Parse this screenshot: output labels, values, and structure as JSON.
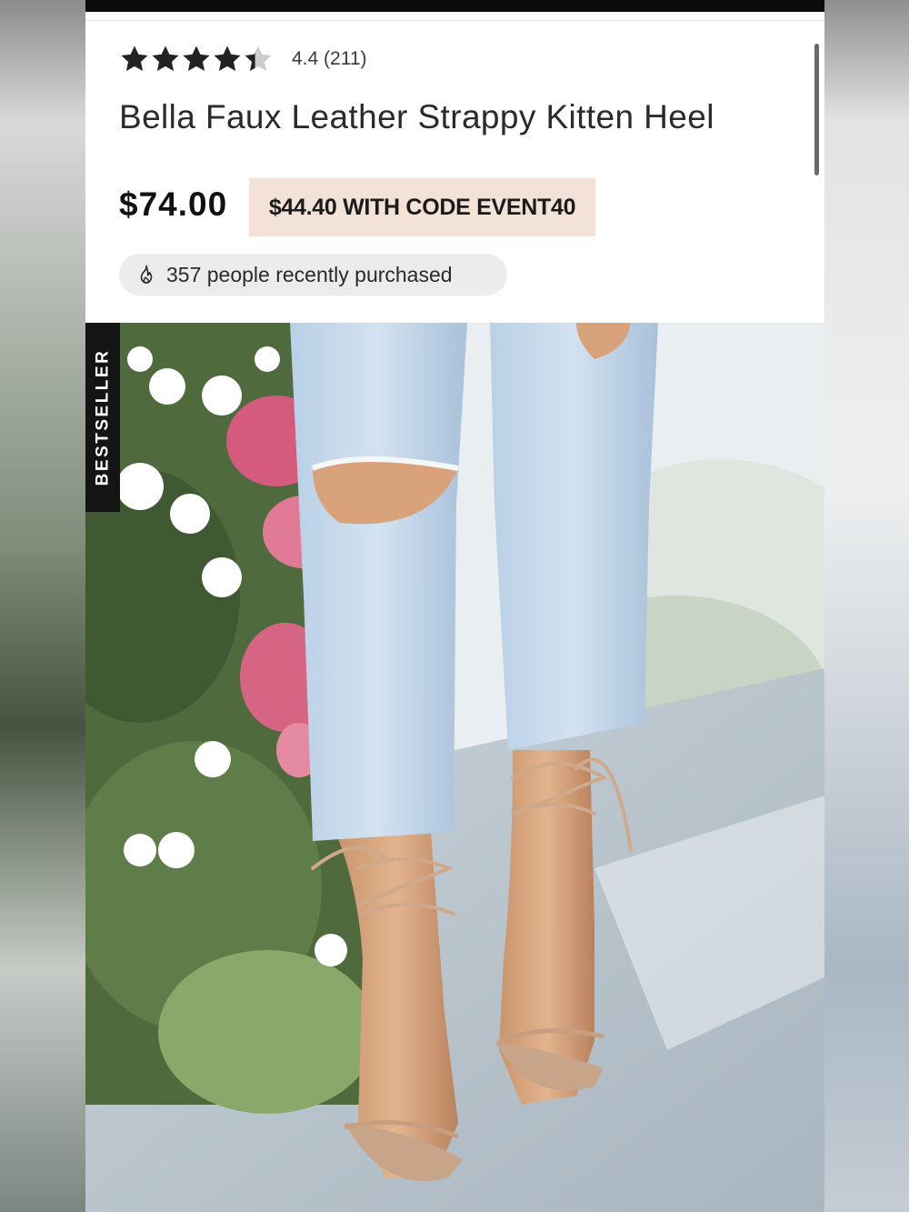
{
  "product": {
    "rating_value": 4.4,
    "rating_text": "4.4 (211)",
    "title": "Bella Faux Leather Strappy Kitten Heel",
    "price": "$74.00",
    "promo": "$44.40 WITH CODE EVENT40",
    "recent_purchases": "357 people recently purchased",
    "badge": "BESTSELLER"
  },
  "icons": {
    "rating": "star-icon",
    "purchases": "fire-icon"
  },
  "colors": {
    "promo_bg": "#f3e2d8",
    "star": "#222222",
    "star_empty": "#cccccc",
    "badge_bg": "#141414",
    "pill_bg": "#ececec"
  }
}
